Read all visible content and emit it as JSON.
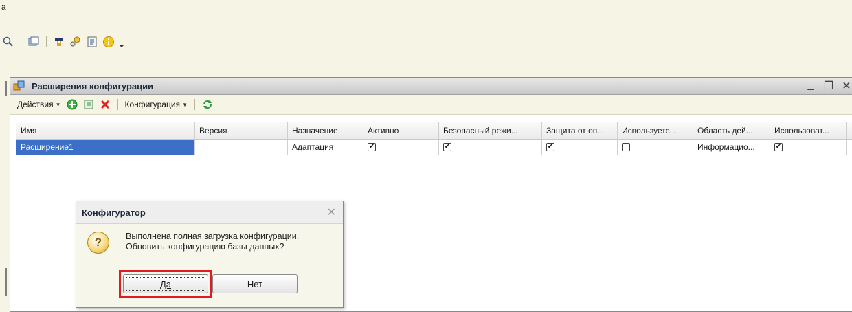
{
  "menu_stub": "а",
  "main_toolbar": {
    "icons": [
      "search-icon",
      "window-icon",
      "wizard-icon",
      "find-icon",
      "notes-icon",
      "info-icon"
    ]
  },
  "window": {
    "title": "Расширения конфигурации",
    "controls": [
      "_",
      "❐",
      "✕"
    ]
  },
  "toolbar": {
    "actions_label": "Действия",
    "config_label": "Конфигурация",
    "icons": [
      "add-icon",
      "edit-icon",
      "delete-icon",
      "refresh-icon"
    ]
  },
  "grid": {
    "columns": [
      "Имя",
      "Версия",
      "Назначение",
      "Активно",
      "Безопасный режи...",
      "Защита от оп...",
      "Используетс...",
      "Область дей...",
      "Использоват..."
    ],
    "rows": [
      {
        "name": "Расширение1",
        "version": "",
        "purpose": "Адаптация",
        "active": true,
        "safe_mode": true,
        "protection": true,
        "used": false,
        "scope": "Информацио...",
        "user_data": true
      }
    ]
  },
  "dialog": {
    "title": "Конфигуратор",
    "message_line1": "Выполнена полная загрузка конфигурации.",
    "message_line2": "Обновить конфигурацию базы данных?",
    "yes_label": "Да",
    "no_label": "Нет",
    "highlight_color": "#e01b24"
  }
}
